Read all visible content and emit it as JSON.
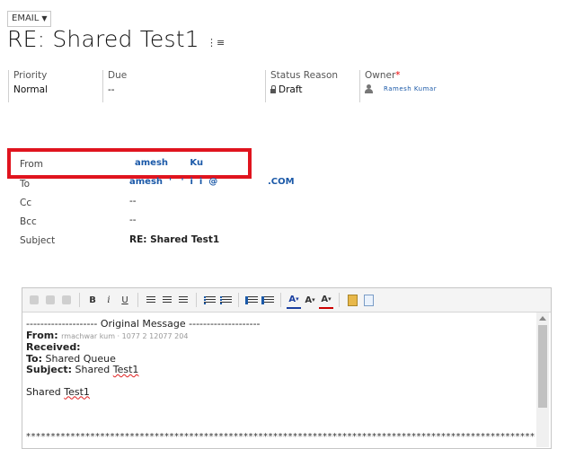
{
  "header": {
    "entity_label": "EMAIL",
    "title": "RE: Shared Test1",
    "title_menu_glyph": "⋮≡"
  },
  "summary": {
    "priority_label": "Priority",
    "priority_value": "Normal",
    "due_label": "Due",
    "due_value": "--",
    "status_label": "Status Reason",
    "status_value": "Draft",
    "owner_label": "Owner",
    "owner_required": "*",
    "owner_value": "Ramesh                 Kumar"
  },
  "fields": {
    "from_label": "From",
    "from_value": "amesh       Ku",
    "to_label": "To",
    "to_value": "amesh  '   '  i  i  @                .COM",
    "cc_label": "Cc",
    "cc_value": "--",
    "bcc_label": "Bcc",
    "bcc_value": "--",
    "subject_label": "Subject",
    "subject_value": "RE: Shared Test1"
  },
  "toolbar": {
    "bold": "B",
    "italic": "i",
    "underline": "U",
    "font_size": "A",
    "font_color": "A",
    "dropdown": "▾"
  },
  "editor": {
    "orig_message": "-------------------- Original Message --------------------",
    "from_label": "From:",
    "from_value": "rmachwar kum   · 1077 2  12077 204",
    "received_label": "Received:",
    "to_label": "To:",
    "to_value": " Shared Queue",
    "subject_label": "Subject:",
    "subject_value_a": " Shared ",
    "subject_value_b": "Test1",
    "body_a": "Shared ",
    "body_b": "Test1",
    "separator": "*************************************************************************************************************"
  },
  "colors": {
    "highlight_border": "#e0141e",
    "link": "#1b59a8"
  }
}
